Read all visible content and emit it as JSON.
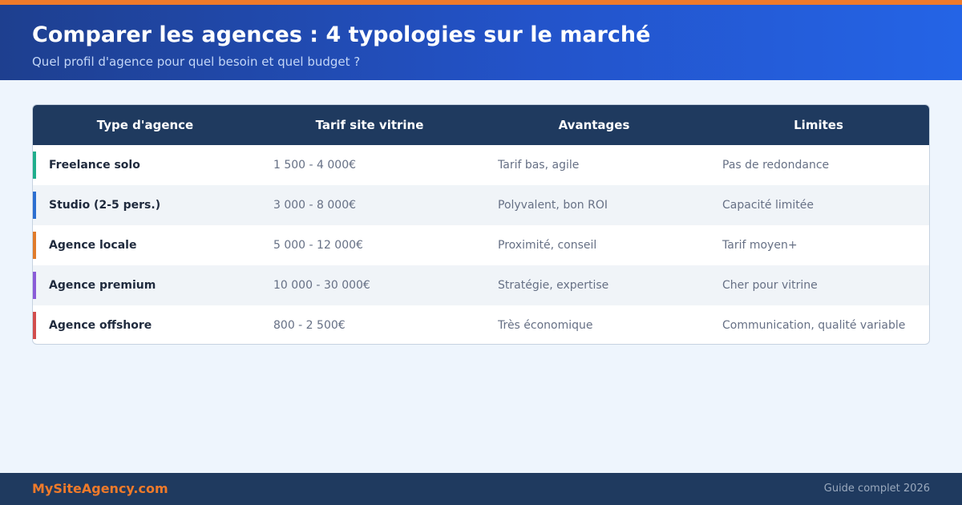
{
  "header": {
    "title": "Comparer les agences : 4 typologies sur le marché",
    "subtitle": "Quel profil d'agence pour quel besoin et quel budget ?"
  },
  "table": {
    "columns": [
      "Type d'agence",
      "Tarif site vitrine",
      "Avantages",
      "Limites"
    ],
    "rows": [
      {
        "type": "Freelance solo",
        "price": "1 500 - 4 000€",
        "pros": "Tarif bas, agile",
        "cons": "Pas de redondance",
        "color": "#1fae8c"
      },
      {
        "type": "Studio (2-5 pers.)",
        "price": "3 000 - 8 000€",
        "pros": "Polyvalent, bon ROI",
        "cons": "Capacité limitée",
        "color": "#2c6fd1"
      },
      {
        "type": "Agence locale",
        "price": "5 000 - 12 000€",
        "pros": "Proximité, conseil",
        "cons": "Tarif moyen+",
        "color": "#e07b2a"
      },
      {
        "type": "Agence premium",
        "price": "10 000 - 30 000€",
        "pros": "Stratégie, expertise",
        "cons": "Cher pour vitrine",
        "color": "#8a5cd8"
      },
      {
        "type": "Agence offshore",
        "price": "800 - 2 500€",
        "pros": "Très économique",
        "cons": "Communication, qualité variable",
        "color": "#d24d4d"
      }
    ]
  },
  "footer": {
    "brand": "MySiteAgency.com",
    "note": "Guide complet 2026"
  },
  "colors": {
    "accent": "#ef7a2a",
    "header_start": "#1e3f8f",
    "header_end": "#2464e6",
    "table_header": "#1f3a5f",
    "background": "#eef5fd"
  }
}
